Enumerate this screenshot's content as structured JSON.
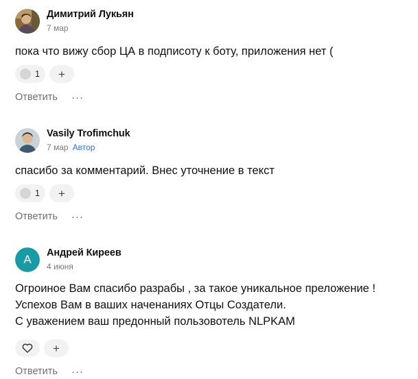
{
  "comments": [
    {
      "author": "Димитрий Лукьян",
      "date": "7 мар",
      "badge": "",
      "avatar_letter": "",
      "text_lines": [
        "пока что вижу сбор ЦА в подписоту к боту, приложения нет ("
      ],
      "reaction_count": "1",
      "reply_label": "Ответить",
      "more_label": "···"
    },
    {
      "author": "Vasily Trofimchuk",
      "date": "7 мар",
      "badge": "Автор",
      "avatar_letter": "",
      "text_lines": [
        "спасибо за комментарий. Внес уточнение в текст"
      ],
      "reaction_count": "1",
      "reply_label": "Ответить",
      "more_label": "···"
    },
    {
      "author": "Андрей Киреев",
      "date": "4 июня",
      "badge": "",
      "avatar_letter": "А",
      "text_lines": [
        "Огроиное Вам спасибо разрабы , за такое уникальное преложение !",
        "Успехов Вам в ваших наченаниях Отцы Создатели.",
        "С уважением ваш предонный пользовотель NLPKAM"
      ],
      "reaction_count": "",
      "reply_label": "Ответить",
      "more_label": "···"
    }
  ],
  "icons": {
    "add_reaction": "plus-icon",
    "like": "heart-icon",
    "more": "more-dots-icon"
  },
  "colors": {
    "avatar_letter_bg": "#1a9aa5",
    "author_badge": "#3b6fd6",
    "pill_bg": "#f2f2f2"
  }
}
